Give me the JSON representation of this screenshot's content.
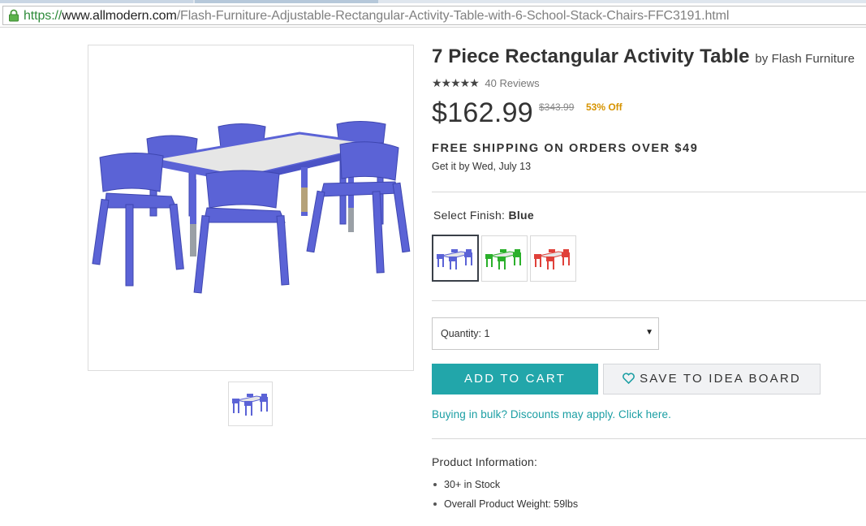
{
  "browser": {
    "url_scheme": "https://",
    "url_host": "www.allmodern.com",
    "url_path": "/Flash-Furniture-Adjustable-Rectangular-Activity-Table-with-6-School-Stack-Chairs-FFC3191.html"
  },
  "product": {
    "title": "7 Piece Rectangular Activity Table",
    "by_brand": "by Flash Furniture",
    "stars": "★★★★★",
    "reviews": "40 Reviews",
    "price": "$162.99",
    "was_price": "$343.99",
    "discount": "53% Off",
    "shipping": "FREE SHIPPING ON ORDERS OVER $49",
    "delivery_prefix": "Get it by ",
    "delivery_date": "Wed, July 13",
    "finish_label": "Select Finish: ",
    "finish_value": "Blue",
    "finishes": [
      {
        "name": "Blue",
        "color": "#5b63d6",
        "selected": true
      },
      {
        "name": "Green",
        "color": "#2bb02b",
        "selected": false
      },
      {
        "name": "Red",
        "color": "#e0413a",
        "selected": false
      }
    ],
    "quantity_label": "Quantity: 1",
    "add_to_cart": "ADD TO CART",
    "save_to_idea_board": "SAVE TO IDEA BOARD",
    "bulk_link": "Buying in bulk? Discounts may apply. Click here.",
    "info_title": "Product Information:",
    "info_items": [
      "30+ in Stock",
      "Overall Product Weight: 59lbs"
    ]
  },
  "colors": {
    "accent": "#22a6aa",
    "discount": "#d69300",
    "chair": "#5b63d6",
    "table_top": "#e6e6e6"
  }
}
